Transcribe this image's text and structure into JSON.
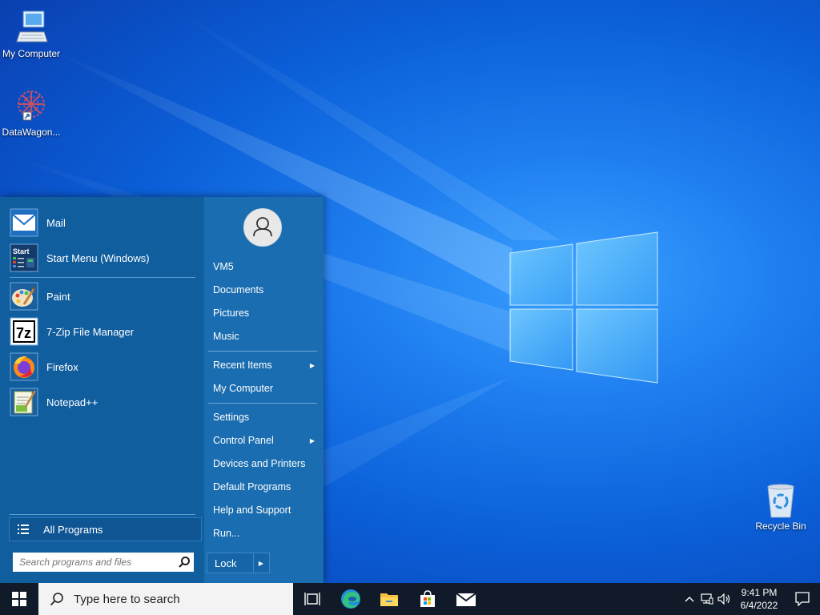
{
  "desktop": {
    "icons": [
      {
        "label": "My Computer"
      },
      {
        "label": "DataWagon..."
      },
      {
        "label": "Recycle Bin"
      }
    ]
  },
  "start_menu": {
    "pinned": [
      {
        "label": "Mail",
        "icon": "mail-icon"
      },
      {
        "label": "Start Menu (Windows)",
        "icon": "start-menu-icon"
      }
    ],
    "recent": [
      {
        "label": "Paint",
        "icon": "paint-icon"
      },
      {
        "label": "7-Zip File Manager",
        "icon": "7zip-icon"
      },
      {
        "label": "Firefox",
        "icon": "firefox-icon"
      },
      {
        "label": "Notepad++",
        "icon": "notepadpp-icon"
      }
    ],
    "all_programs": "All Programs",
    "search_placeholder": "Search programs and files",
    "right": {
      "user": "VM5",
      "items_group1": [
        "Documents",
        "Pictures",
        "Music"
      ],
      "items_group2": [
        {
          "label": "Recent Items",
          "submenu": true
        },
        {
          "label": "My Computer",
          "submenu": false
        }
      ],
      "items_group3": [
        {
          "label": "Settings",
          "submenu": false
        },
        {
          "label": "Control Panel",
          "submenu": true
        },
        {
          "label": "Devices and Printers",
          "submenu": false
        },
        {
          "label": "Default Programs",
          "submenu": false
        },
        {
          "label": "Help and Support",
          "submenu": false
        },
        {
          "label": "Run...",
          "submenu": false
        }
      ],
      "lock": "Lock"
    }
  },
  "taskbar": {
    "search_placeholder": "Type here to search",
    "apps": [
      "task-view-icon",
      "edge-icon",
      "file-explorer-icon",
      "store-icon",
      "mail-icon"
    ],
    "time": "9:41 PM",
    "date": "6/4/2022"
  },
  "colors": {
    "start_menu_left": "#115e9f",
    "start_menu_right": "#1a6db0",
    "taskbar": "#101a28"
  }
}
